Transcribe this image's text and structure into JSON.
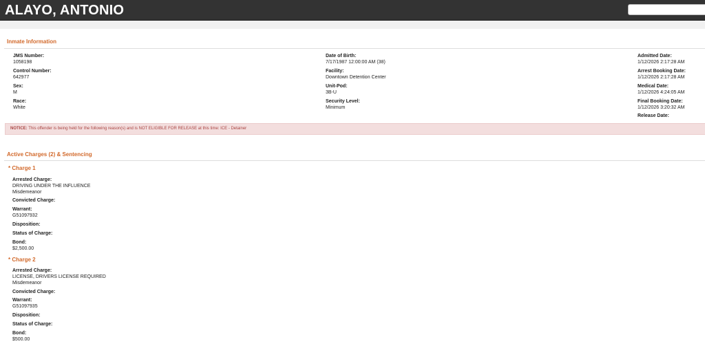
{
  "header": {
    "title": "ALAYO, ANTONIO",
    "search_placeholder": ""
  },
  "inmate": {
    "section_title": "Inmate Information",
    "col1": [
      {
        "label": "JMS Number:",
        "value": "1058198"
      },
      {
        "label": "Control Number:",
        "value": "642977"
      },
      {
        "label": "Sex:",
        "value": "M"
      },
      {
        "label": "Race:",
        "value": "White"
      }
    ],
    "col2": [
      {
        "label": "Date of Birth:",
        "value": "7/17/1987 12:00:00 AM (38)"
      },
      {
        "label": "Facility:",
        "value": "Downtown Detention Center"
      },
      {
        "label": "Unit-Pod:",
        "value": "3B-U"
      },
      {
        "label": "Security Level:",
        "value": "Minimum"
      }
    ],
    "col3": [
      {
        "label": "Admitted Date:",
        "value": "1/12/2026 2:17:28 AM"
      },
      {
        "label": "Arrest Booking Date:",
        "value": "1/12/2026 2:17:28 AM"
      },
      {
        "label": "Medical Date:",
        "value": "1/12/2026 4:24:05 AM"
      },
      {
        "label": "Final Booking Date:",
        "value": "1/12/2026 3:20:32 AM"
      },
      {
        "label": "Release Date:",
        "value": ""
      }
    ]
  },
  "notice": {
    "prefix": "NOTICE:",
    "text": " This offender is being held for the following reason(s) and is NOT ELIGIBLE FOR RELEASE at this time: ICE - Detainer"
  },
  "charges": {
    "section_title": "Active Charges (2)  &  Sentencing",
    "items": [
      {
        "title": "* Charge 1",
        "arrested_label": "Arrested Charge:",
        "arrested_value": "DRIVING UNDER THE INFLUENCE",
        "arrested_class": "Misdemeanor",
        "convicted_label": "Convicted Charge:",
        "convicted_value": "",
        "warrant_label": "Warrant:",
        "warrant_value": "G51097932",
        "disposition_label": "Disposition:",
        "disposition_value": "",
        "status_label": "Status of Charge:",
        "status_value": "",
        "bond_label": "Bond:",
        "bond_value": "$2,500.00"
      },
      {
        "title": "* Charge 2",
        "arrested_label": "Arrested Charge:",
        "arrested_value": "LICENSE, DRIVERS LICENSE REQUIRED",
        "arrested_class": "Misdemeanor",
        "convicted_label": "Convicted Charge:",
        "convicted_value": "",
        "warrant_label": "Warrant:",
        "warrant_value": "G51097935",
        "disposition_label": "Disposition:",
        "disposition_value": "",
        "status_label": "Status of Charge:",
        "status_value": "",
        "bond_label": "Bond:",
        "bond_value": "$500.00"
      }
    ]
  },
  "colors": {
    "header_bg": "#333333",
    "accent": "#d2692b",
    "notice_bg": "#f3dede",
    "notice_text": "#a94442"
  }
}
